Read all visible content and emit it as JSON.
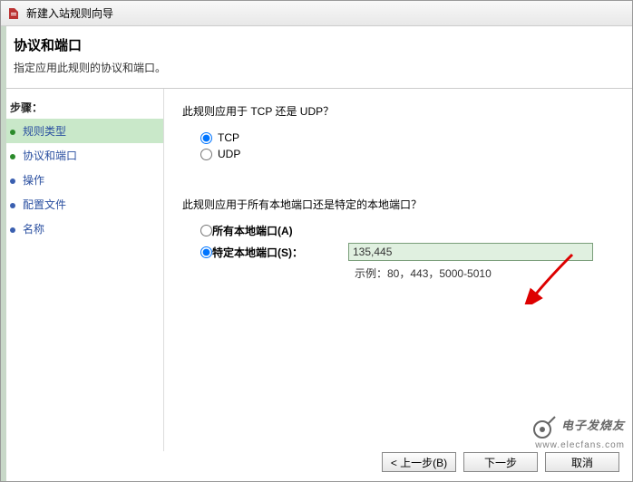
{
  "window": {
    "title": "新建入站规则向导"
  },
  "header": {
    "heading": "协议和端口",
    "sub": "指定应用此规则的协议和端口。"
  },
  "sidebar": {
    "title": "步骤：",
    "items": [
      {
        "label": "规则类型"
      },
      {
        "label": "协议和端口"
      },
      {
        "label": "操作"
      },
      {
        "label": "配置文件"
      },
      {
        "label": "名称"
      }
    ]
  },
  "content": {
    "q1": "此规则应用于 TCP 还是 UDP？",
    "tcp": "TCP",
    "udp": "UDP",
    "q2": "此规则应用于所有本地端口还是特定的本地端口？",
    "all_ports": "所有本地端口(A)",
    "specific_ports": "特定本地端口(S)：",
    "port_value": "135,445",
    "example": "示例：80，443，5000-5010"
  },
  "footer": {
    "back": "< 上一步(B)",
    "next": "下一步",
    "cancel": "取消"
  },
  "watermark": {
    "brand": "电子发烧友",
    "url": "www.elecfans.com"
  }
}
